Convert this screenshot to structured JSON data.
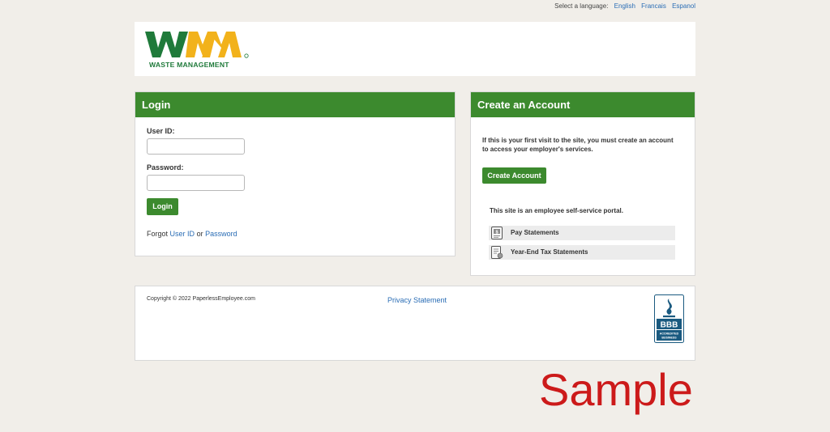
{
  "language_bar": {
    "prompt": "Select a language:",
    "options": [
      "English",
      "Francais",
      "Espanol"
    ]
  },
  "brand": {
    "logo_mark": "WM",
    "logo_text": "WASTE MANAGEMENT",
    "colors": {
      "green": "#1f7a3a",
      "yellow": "#f2b21b",
      "accent": "#3c8a2e"
    }
  },
  "login": {
    "title": "Login",
    "user_id_label": "User ID:",
    "user_id_value": "",
    "password_label": "Password:",
    "password_value": "",
    "button": "Login",
    "forgot_prefix": "Forgot",
    "forgot_user_id": "User ID",
    "forgot_or": "or",
    "forgot_password": "Password"
  },
  "create_account": {
    "title": "Create an Account",
    "intro": "If this is your first visit to the site, you must create an account to access your employer's services.",
    "button": "Create Account",
    "portal_text": "This site is an employee self-service portal.",
    "features": [
      {
        "label": "Pay Statements",
        "icon": "pay-statements-icon"
      },
      {
        "label": "Year-End Tax Statements",
        "icon": "tax-statements-icon"
      }
    ]
  },
  "footer": {
    "copyright": "Copyright © 2022 PaperlessEmployee.com",
    "privacy": "Privacy Statement",
    "bbb_mark": "BBB",
    "bbb_line1": "ACCREDITED",
    "bbb_line2": "BUSINESS"
  },
  "watermark": "Sample"
}
